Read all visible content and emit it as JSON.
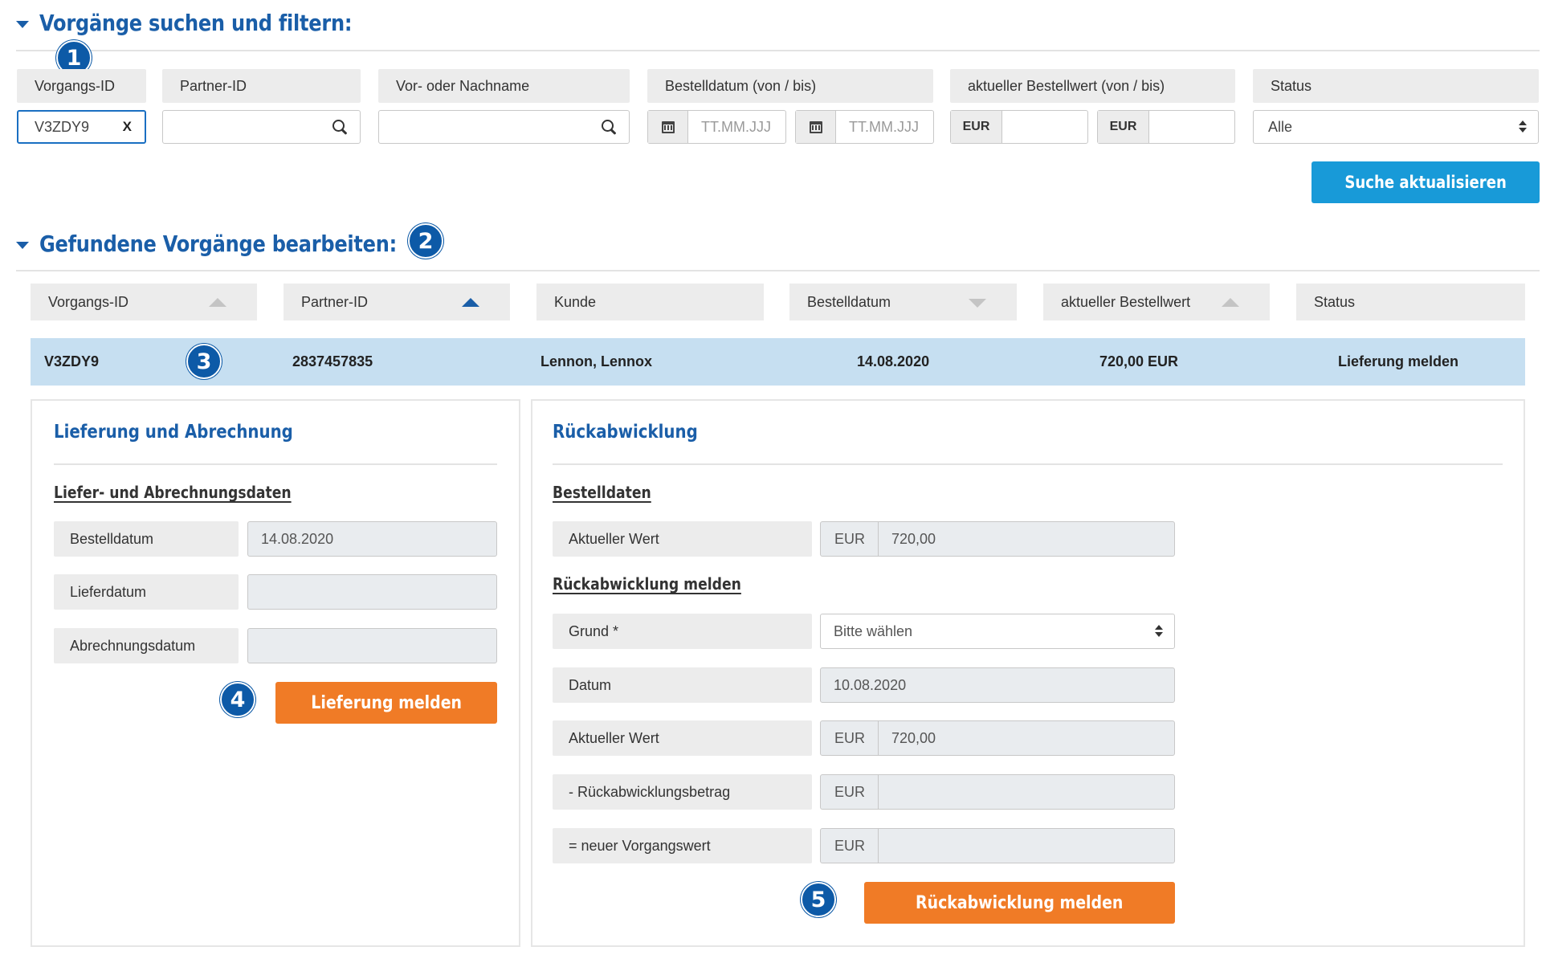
{
  "search": {
    "title": "Vorgänge suchen und filtern:",
    "labels": {
      "vorgangs_id": "Vorgangs-ID",
      "partner_id": "Partner-ID",
      "name": "Vor- oder Nachname",
      "bestelldatum": "Bestelldatum (von / bis)",
      "bestellwert": "aktueller Bestellwert (von / bis)",
      "status": "Status"
    },
    "vorgangs_id_value": "V3ZDY9",
    "clear_label": "X",
    "date_placeholder": "TT.MM.JJJ",
    "currency": "EUR",
    "status_value": "Alle",
    "update_button": "Suche aktualisieren"
  },
  "results": {
    "title": "Gefundene Vorgänge bearbeiten:",
    "columns": [
      "Vorgangs-ID",
      "Partner-ID",
      "Kunde",
      "Bestelldatum",
      "aktueller Bestellwert",
      "Status"
    ],
    "row": {
      "vorgangs_id": "V3ZDY9",
      "partner_id": "2837457835",
      "kunde": "Lennon, Lennox",
      "bestelldatum": "14.08.2020",
      "bestellwert": "720,00 EUR",
      "status": "Lieferung melden"
    }
  },
  "delivery_panel": {
    "title": "Lieferung und Abrechnung",
    "subtitle": "Liefer- und Abrechnungsdaten",
    "fields": [
      {
        "label": "Bestelldatum",
        "value": "14.08.2020"
      },
      {
        "label": "Lieferdatum",
        "value": ""
      },
      {
        "label": "Abrechnungsdatum",
        "value": ""
      }
    ],
    "button": "Lieferung melden"
  },
  "return_panel": {
    "title": "Rückabwicklung",
    "order_subtitle": "Bestelldaten",
    "current_value_label": "Aktueller Wert",
    "current_value": "720,00",
    "report_subtitle": "Rückabwicklung melden",
    "grund_label": "Grund *",
    "grund_value": "Bitte wählen",
    "datum_label": "Datum",
    "datum_value": "10.08.2020",
    "aktueller_wert_label": "Aktueller Wert",
    "aktueller_wert_value": "720,00",
    "betrag_label": "- Rückabwicklungsbetrag",
    "neuer_wert_label": "= neuer Vorgangswert",
    "currency": "EUR",
    "button": "Rückabwicklung melden"
  },
  "badges": [
    "1",
    "2",
    "3",
    "4",
    "5"
  ],
  "colors": {
    "heading_blue": "#1a5ea8",
    "badge_blue": "#0d5aa7",
    "button_blue": "#189ad8",
    "button_orange": "#f07b26",
    "row_highlight": "#c6dff1"
  }
}
